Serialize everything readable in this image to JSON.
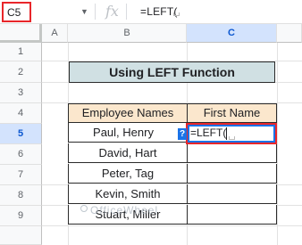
{
  "formula_bar": {
    "name_box": "C5",
    "fx_symbol": "fx",
    "formula": "=LEFT("
  },
  "columns": [
    "A",
    "B",
    "C"
  ],
  "rows": [
    "1",
    "2",
    "3",
    "4",
    "5",
    "6",
    "7",
    "8",
    "9"
  ],
  "selected_cell": {
    "column": "C",
    "row": "5"
  },
  "title": "Using LEFT Function",
  "table": {
    "headers": [
      "Employee Names",
      "First Name"
    ],
    "rows": [
      [
        "Paul, Henry",
        "=LEFT("
      ],
      [
        "David, Hart",
        ""
      ],
      [
        "Peter, Tag",
        ""
      ],
      [
        "Kevin, Smith",
        ""
      ],
      [
        "Stuart, Miller",
        ""
      ]
    ]
  },
  "help_icon": "?",
  "watermark": "OfficeWheel",
  "colors": {
    "title_fill": "#d0e0e3",
    "header_fill": "#fbe7cd",
    "highlight_border": "#e8262a",
    "active_border": "#1a73e8"
  }
}
